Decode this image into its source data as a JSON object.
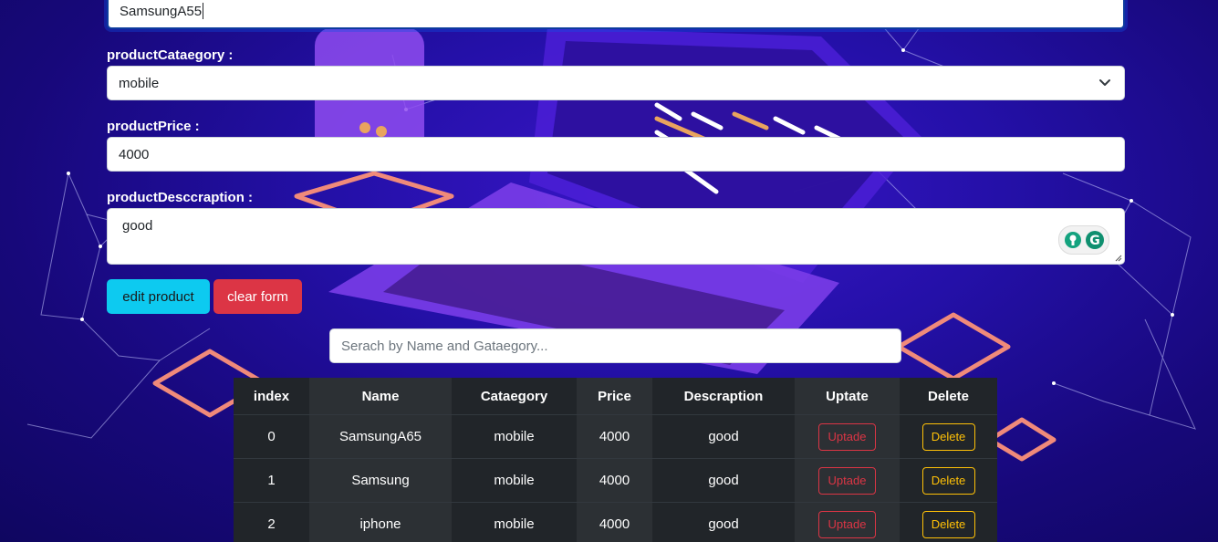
{
  "form": {
    "name_value": "SamsungA55",
    "category_label": "productCataegory :",
    "category_value": "mobile",
    "price_label": "productPrice :",
    "price_value": "4000",
    "description_label": "productDesccraption :",
    "description_value": "good"
  },
  "buttons": {
    "edit_label": "edit product",
    "clear_label": "clear form"
  },
  "search": {
    "placeholder": "Serach by Name and Gataegory..."
  },
  "table": {
    "headers": [
      "index",
      "Name",
      "Cataegory",
      "Price",
      "Descraption",
      "Uptate",
      "Delete"
    ],
    "rows": [
      {
        "index": "0",
        "name": "SamsungA65",
        "category": "mobile",
        "price": "4000",
        "description": "good",
        "update_label": "Uptade",
        "delete_label": "Delete"
      },
      {
        "index": "1",
        "name": "Samsung",
        "category": "mobile",
        "price": "4000",
        "description": "good",
        "update_label": "Uptade",
        "delete_label": "Delete"
      },
      {
        "index": "2",
        "name": "iphone",
        "category": "mobile",
        "price": "4000",
        "description": "good",
        "update_label": "Uptade",
        "delete_label": "Delete"
      }
    ]
  },
  "colors": {
    "background": "#2410a8",
    "edit_button": "#0dcaf0",
    "clear_button": "#dc3545",
    "update_outline": "#dc3545",
    "delete_outline": "#ffc107",
    "table_bg": "#212529"
  },
  "icons": {
    "select_arrow": "chevron-down-icon",
    "grammarly": "grammarly-icon"
  }
}
